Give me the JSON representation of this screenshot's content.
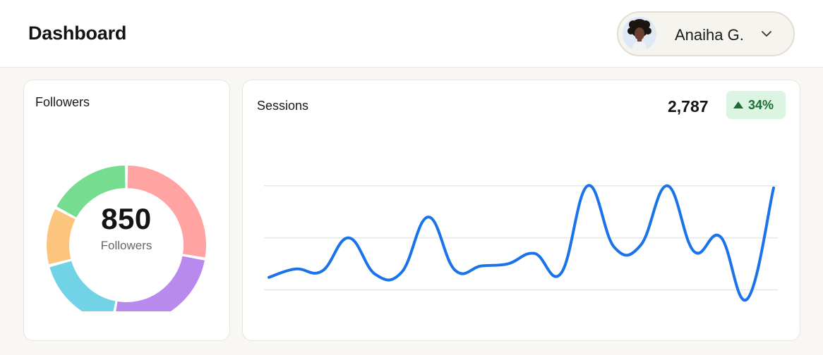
{
  "header": {
    "title": "Dashboard",
    "user": {
      "name": "Anaiha G.",
      "avatar_icon": "user-avatar-icon"
    },
    "dropdown_icon": "chevron-down-icon"
  },
  "followers": {
    "title": "Followers",
    "total": "850",
    "total_label": "Followers",
    "segments": [
      {
        "color": "#ffa3a3",
        "start_deg": 0,
        "end_deg": 100
      },
      {
        "color": "#b98aed",
        "start_deg": 100,
        "end_deg": 190
      },
      {
        "color": "#73d3e6",
        "start_deg": 190,
        "end_deg": 255
      },
      {
        "color": "#fbc57e",
        "start_deg": 255,
        "end_deg": 298
      },
      {
        "color": "#76dc8f",
        "start_deg": 298,
        "end_deg": 360
      }
    ]
  },
  "sessions": {
    "title": "Sessions",
    "total": "2,787",
    "change": "34%",
    "change_direction": "up",
    "line_color": "#1a73e8"
  },
  "chart_data": {
    "type": "line",
    "grid": "horizontal",
    "series": [
      {
        "values": [
          12,
          20,
          18,
          50,
          15,
          17,
          70,
          19,
          23,
          25,
          35,
          16,
          100,
          41,
          43,
          100,
          37,
          51,
          -9,
          98
        ]
      }
    ],
    "ylim": [
      -20,
      110
    ]
  }
}
